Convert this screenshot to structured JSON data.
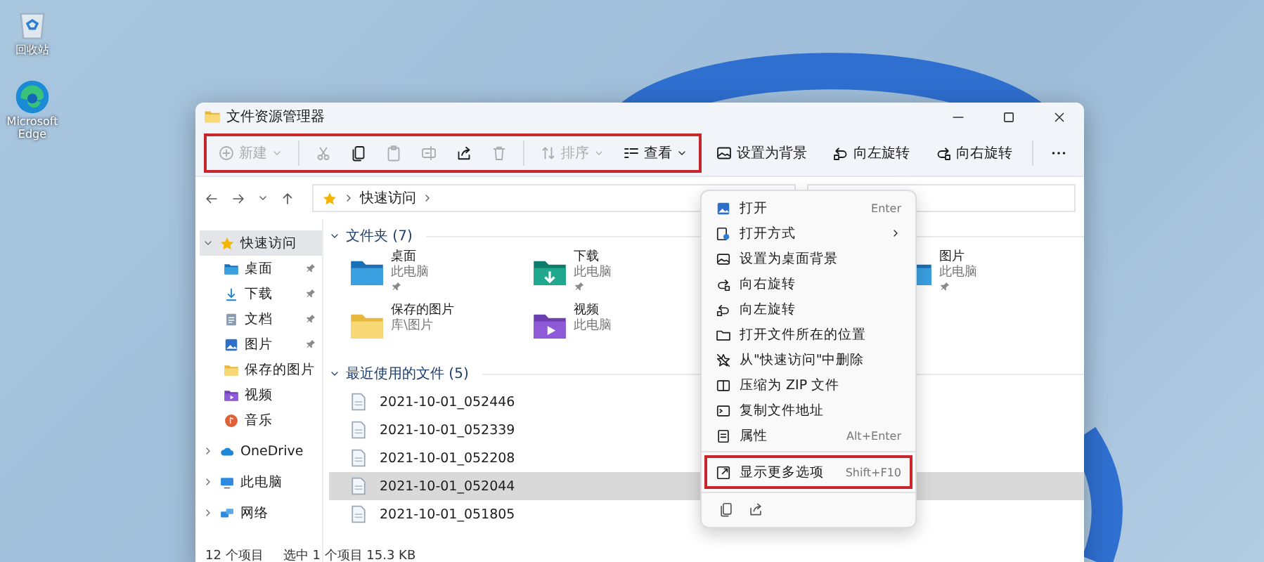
{
  "desktop": {
    "icons": [
      {
        "label": "回收站"
      },
      {
        "label": "Microsoft Edge"
      }
    ]
  },
  "window": {
    "title": "文件资源管理器"
  },
  "toolbar": {
    "group": {
      "highlighted": true,
      "buttons": [
        {
          "kind": "menu",
          "label": "新建",
          "disabled": true
        },
        {
          "kind": "icon",
          "disabled": true
        },
        {
          "kind": "icon",
          "disabled": false
        },
        {
          "kind": "icon",
          "disabled": true
        },
        {
          "kind": "icon",
          "disabled": true
        },
        {
          "kind": "icon",
          "disabled": false
        },
        {
          "kind": "icon",
          "disabled": true
        },
        {
          "kind": "menu",
          "label": "排序",
          "disabled": true
        },
        {
          "kind": "menu",
          "label": "查看",
          "disabled": false
        }
      ]
    },
    "actions": [
      {
        "label": "设置为背景"
      },
      {
        "label": "向左旋转"
      },
      {
        "label": "向右旋转"
      }
    ]
  },
  "address": {
    "path": [
      "快速访问"
    ]
  },
  "sidebar": {
    "items": [
      {
        "label": "快速访问",
        "selected": true,
        "expanded": true,
        "children": [
          {
            "label": "桌面",
            "selected": false,
            "pinned": true
          },
          {
            "label": "下载",
            "selected": false,
            "pinned": true
          },
          {
            "label": "文档",
            "selected": false,
            "pinned": true
          },
          {
            "label": "图片",
            "selected": false,
            "pinned": true
          },
          {
            "label": "保存的图片",
            "selected": false,
            "pinned": false
          },
          {
            "label": "视频",
            "selected": false,
            "pinned": false
          },
          {
            "label": "音乐",
            "selected": false,
            "pinned": false
          }
        ]
      },
      {
        "label": "OneDrive",
        "selected": false,
        "expanded": false
      },
      {
        "label": "此电脑",
        "selected": false,
        "expanded": false
      },
      {
        "label": "网络",
        "selected": false,
        "expanded": false
      }
    ]
  },
  "folders": {
    "title": "文件夹 (7)",
    "expanded": true,
    "items": [
      {
        "name": "桌面",
        "location": "此电脑",
        "pinned": true
      },
      {
        "name": "下载",
        "location": "此电脑",
        "pinned": true
      },
      {
        "name": "图片",
        "location": "此电脑",
        "pinned": true
      },
      {
        "name": "保存的图片",
        "location": "库\\图片",
        "pinned": false
      },
      {
        "name": "视频",
        "location": "此电脑",
        "pinned": false
      }
    ]
  },
  "recent": {
    "title": "最近使用的文件 (5)",
    "expanded": true,
    "files": [
      {
        "name": "2021-10-01_052446",
        "selected": false
      },
      {
        "name": "2021-10-01_052339",
        "selected": false
      },
      {
        "name": "2021-10-01_052208",
        "selected": false
      },
      {
        "name": "2021-10-01_052044",
        "selected": true
      },
      {
        "name": "2021-10-01_051805",
        "selected": false
      }
    ]
  },
  "status_bar": {
    "items": [
      "12 个项目",
      "选中 1 个项目  15.3 KB"
    ]
  },
  "context_menu": {
    "items": [
      {
        "kind": "item",
        "label": "打开",
        "shortcut": "Enter",
        "highlighted": false
      },
      {
        "kind": "submenu",
        "label": "打开方式",
        "highlighted": false
      },
      {
        "kind": "item",
        "label": "设置为桌面背景",
        "highlighted": false
      },
      {
        "kind": "item",
        "label": "向右旋转",
        "highlighted": false
      },
      {
        "kind": "item",
        "label": "向左旋转",
        "highlighted": false
      },
      {
        "kind": "item",
        "label": "打开文件所在的位置",
        "highlighted": false
      },
      {
        "kind": "item",
        "label": "从\"快速访问\"中删除",
        "highlighted": false
      },
      {
        "kind": "item",
        "label": "压缩为 ZIP 文件",
        "highlighted": false
      },
      {
        "kind": "item",
        "label": "复制文件地址",
        "highlighted": false
      },
      {
        "kind": "item",
        "label": "属性",
        "shortcut": "Alt+Enter",
        "highlighted": false
      },
      {
        "kind": "separator"
      },
      {
        "kind": "item",
        "label": "显示更多选项",
        "shortcut": "Shift+F10",
        "highlighted": true
      }
    ]
  }
}
